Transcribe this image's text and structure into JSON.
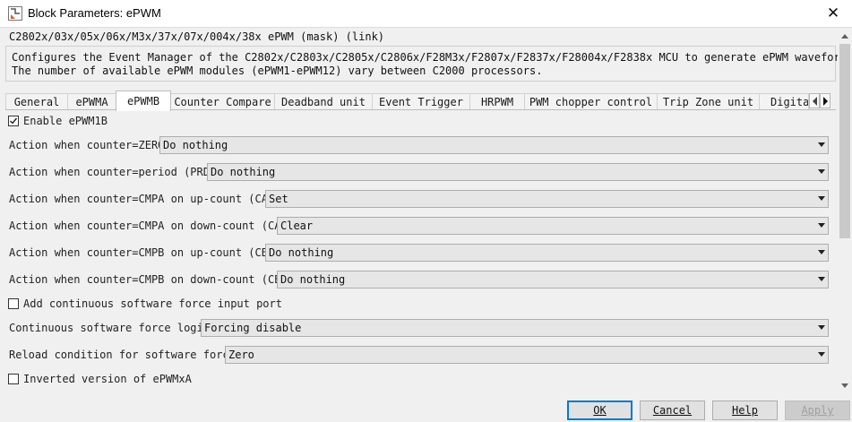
{
  "window": {
    "title": "Block Parameters: ePWM"
  },
  "header": {
    "block_name": "C2802x/03x/05x/06x/M3x/37x/07x/004x/38x ePWM (mask) (link)",
    "description": [
      "Configures the Event Manager of the C2802x/C2803x/C2805x/C2806x/F28M3x/F2807x/F2837x/F28004x/F2838x MCU to generate ePWM waveforms.",
      "The number of available ePWM modules (ePWM1-ePWM12) vary between C2000 processors."
    ]
  },
  "tabs": [
    {
      "label": "General"
    },
    {
      "label": "ePWMA"
    },
    {
      "label": "ePWMB"
    },
    {
      "label": "Counter Compare"
    },
    {
      "label": "Deadband unit"
    },
    {
      "label": "Event Trigger"
    },
    {
      "label": "HRPWM"
    },
    {
      "label": "PWM chopper control"
    },
    {
      "label": "Trip Zone unit"
    },
    {
      "label": "Digita"
    }
  ],
  "active_tab": "ePWMB",
  "form": {
    "enable": {
      "label": "Enable ePWM1B",
      "checked": true
    },
    "zero": {
      "label": "Action when counter=ZERO:",
      "value": "Do nothing"
    },
    "prd": {
      "label": "Action when counter=period (PRD):",
      "value": "Do nothing"
    },
    "cau": {
      "label": "Action when counter=CMPA on up-count (CAU):",
      "value": "Set"
    },
    "cad": {
      "label": "Action when counter=CMPA on down-count (CAD):",
      "value": "Clear"
    },
    "cbu": {
      "label": "Action when counter=CMPB on up-count (CBU):",
      "value": "Do nothing"
    },
    "cbd": {
      "label": "Action when counter=CMPB on down-count (CBD):",
      "value": "Do nothing"
    },
    "add_port": {
      "label": "Add continuous software force input port",
      "checked": false
    },
    "force_logic": {
      "label": "Continuous software force logic:",
      "value": "Forcing disable"
    },
    "reload": {
      "label": "Reload condition for software force:",
      "value": "Zero"
    },
    "inverted": {
      "label": "Inverted version of ePWMxA",
      "checked": false
    }
  },
  "buttons": {
    "ok": "OK",
    "cancel": "Cancel",
    "help": "Help",
    "apply": "Apply"
  }
}
